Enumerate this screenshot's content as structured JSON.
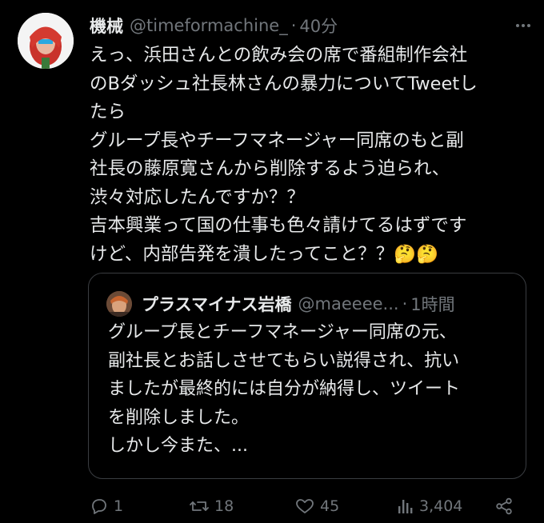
{
  "author": {
    "display_name": "機械",
    "handle": "@timeformachine_",
    "separator": "·",
    "time": "40分"
  },
  "tweet": {
    "lines": [
      "えっ、浜田さんとの飲み会の席で番組制作会社",
      "のBダッシュ社長林さんの暴力についてTweetし",
      "たら",
      "グループ長やチーフマネージャー同席のもと副",
      "社長の藤原寛さんから削除するよう迫られ、",
      "渋々対応したんですか？？",
      "吉本興業って国の仕事も色々請けてるはずです",
      "けど、内部告発を潰したってこと？？🤔🤔"
    ]
  },
  "quoted": {
    "display_name": "プラスマイナス岩橋",
    "handle": "@maeeee...",
    "separator": "·",
    "time": "1時間",
    "lines": [
      "グループ長とチーフマネージャー同席の元、",
      "副社長とお話しさせてもらい説得され、抗い",
      "ましたが最終的には自分が納得し、ツイート",
      "を削除しました。",
      "しかし今また、..."
    ]
  },
  "actions": {
    "reply_count": "1",
    "retweet_count": "18",
    "like_count": "45",
    "view_count": "3,404"
  },
  "icons": {
    "reply": "reply-icon",
    "retweet": "retweet-icon",
    "like": "heart-icon",
    "views": "views-icon",
    "share": "share-icon",
    "more": "more-icon"
  },
  "colors": {
    "background": "#000000",
    "text": "#e7e9ea",
    "secondary": "#71767b",
    "border": "#3a3d41"
  }
}
